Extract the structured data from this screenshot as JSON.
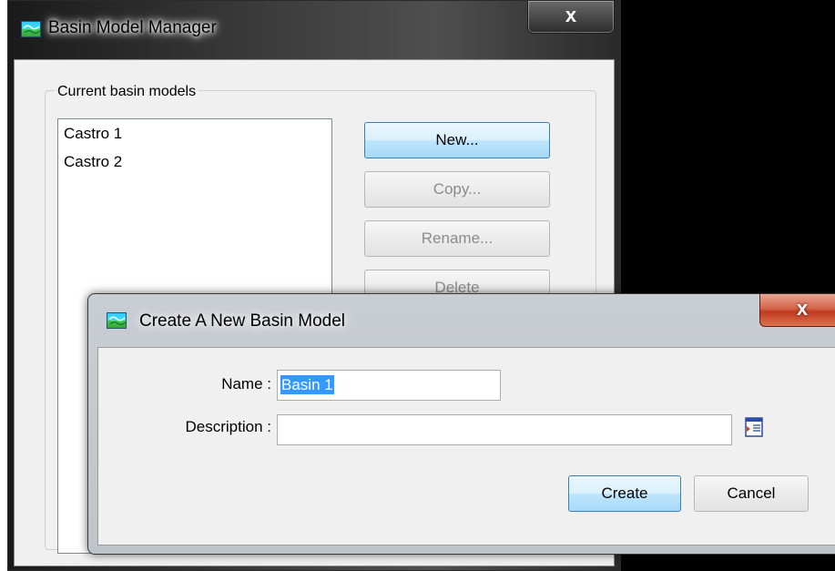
{
  "basin_manager": {
    "title": "Basin Model Manager",
    "close_label": "x",
    "group_label": "Current basin models",
    "models": [
      "Castro 1",
      "Castro 2"
    ],
    "buttons": {
      "new": "New...",
      "copy": "Copy...",
      "rename": "Rename...",
      "delete": "Delete"
    }
  },
  "create_dialog": {
    "title": "Create A New Basin Model",
    "close_label": "x",
    "name_label": "Name :",
    "name_value": "Basin 1",
    "description_label": "Description :",
    "description_value": "",
    "create_button": "Create",
    "cancel_button": "Cancel"
  },
  "icons": {
    "app": "hec-hms-basin-icon",
    "description_editor": "edit-description-icon"
  },
  "colors": {
    "selection": "#3399ff",
    "primary_button_border": "#3c7fb1",
    "close_button_red": "#c0391f"
  }
}
